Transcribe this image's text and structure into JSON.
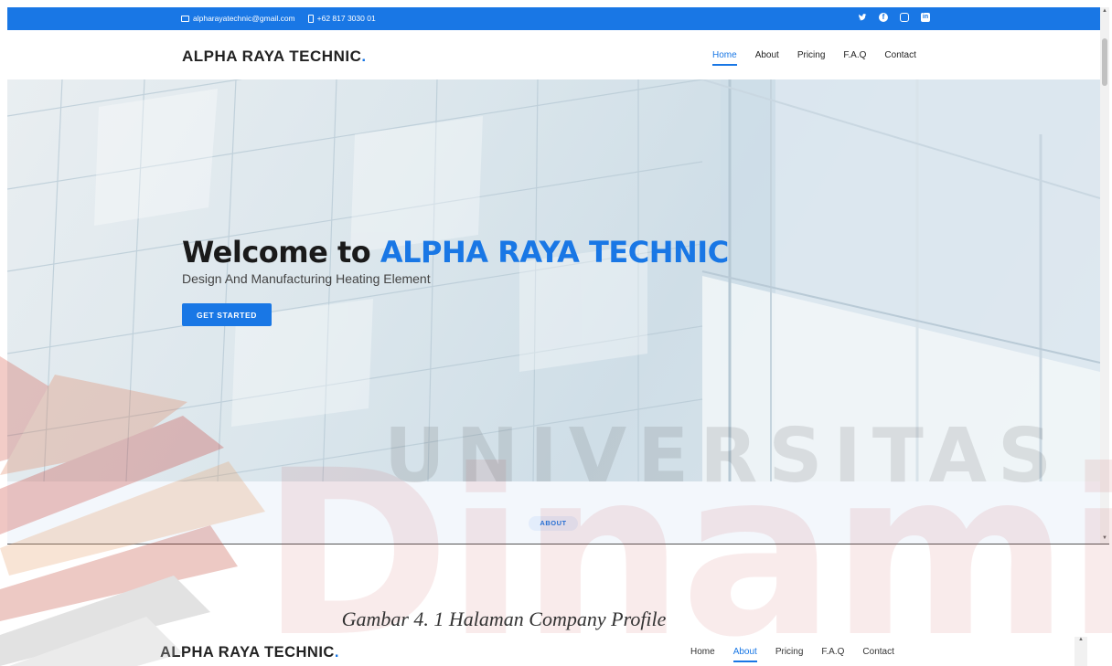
{
  "topbar": {
    "email": "alpharayatechnic@gmail.com",
    "phone": "+62 817 3030 01",
    "social": [
      "twitter-icon",
      "facebook-icon",
      "instagram-icon",
      "linkedin-icon"
    ]
  },
  "navbar": {
    "brand": "ALPHA RAYA TECHNIC",
    "brand_dot": ".",
    "items": [
      "Home",
      "About",
      "Pricing",
      "F.A.Q",
      "Contact"
    ],
    "active": "Home"
  },
  "hero": {
    "title_prefix": "Welcome to ",
    "title_highlight": "ALPHA RAYA TECHNIC",
    "subtitle": "Design And Manufacturing Heating Element",
    "cta_label": "GET STARTED"
  },
  "about": {
    "label": "ABOUT"
  },
  "watermark": {
    "word": "UNIVERSITAS",
    "big": "Dinamika"
  },
  "caption": "Gambar 4. 1 Halaman Company Profile",
  "navbar2": {
    "brand": "ALPHA RAYA TECHNIC",
    "brand_dot": ".",
    "items": [
      "Home",
      "About",
      "Pricing",
      "F.A.Q",
      "Contact"
    ],
    "active": "About"
  },
  "colors": {
    "accent": "#1977e5",
    "text": "#1a1a1a",
    "watermark": "#c83c3c"
  }
}
